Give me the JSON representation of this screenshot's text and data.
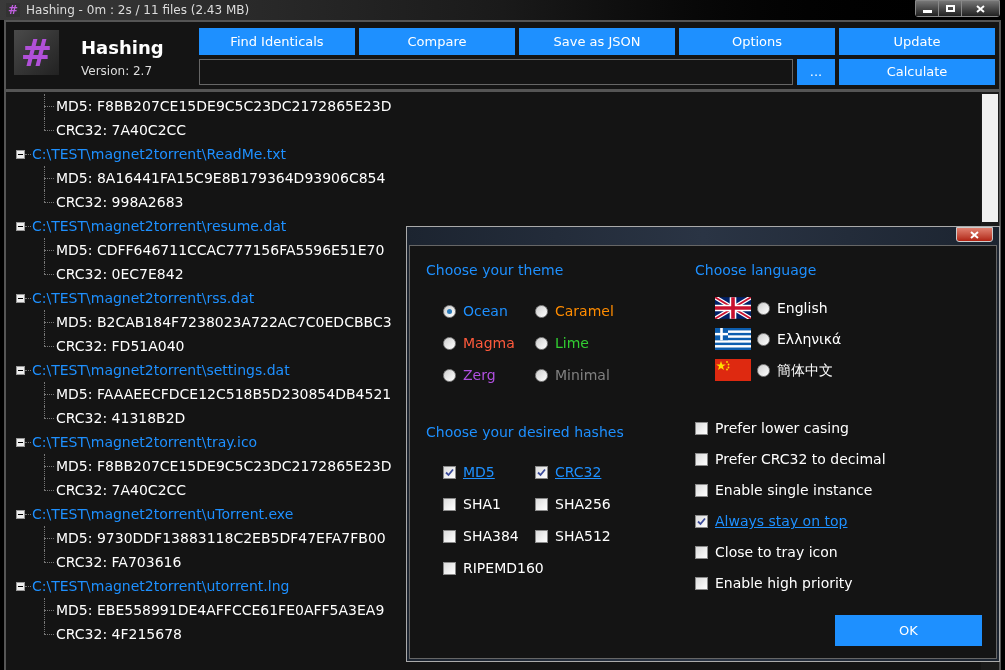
{
  "window": {
    "title": "Hashing - 0m : 2s / 11 files (2.43 MB)"
  },
  "header": {
    "logo": "#",
    "app_name": "Hashing",
    "version": "Version: 2.7"
  },
  "toolbar": [
    "Find Identicals",
    "Compare",
    "Save as JSON",
    "Options",
    "Update"
  ],
  "browse_button": "...",
  "calculate_button": "Calculate",
  "tree": [
    {
      "hashes": [
        "MD5: F8BB207CE15DE9C5C23DC2172865E23D",
        "CRC32: 7A40C2CC"
      ]
    },
    {
      "path": "C:\\TEST\\magnet2torrent\\ReadMe.txt",
      "expanded": true,
      "hashes": [
        "MD5: 8A16441FA15C9E8B179364D93906C854",
        "CRC32: 998A2683"
      ]
    },
    {
      "path": "C:\\TEST\\magnet2torrent\\resume.dat",
      "expanded": true,
      "hashes": [
        "MD5: CDFF646711CCAC777156FA5596E51E70",
        "CRC32: 0EC7E842"
      ]
    },
    {
      "path": "C:\\TEST\\magnet2torrent\\rss.dat",
      "expanded": true,
      "hashes": [
        "MD5: B2CAB184F7238023A722AC7C0EDCBBC3",
        "CRC32: FD51A040"
      ]
    },
    {
      "path": "C:\\TEST\\magnet2torrent\\settings.dat",
      "expanded": true,
      "hashes": [
        "MD5: FAAAEECFDCE12C518B5D230854DB4521",
        "CRC32: 41318B2D"
      ]
    },
    {
      "path": "C:\\TEST\\magnet2torrent\\tray.ico",
      "expanded": true,
      "hashes": [
        "MD5: F8BB207CE15DE9C5C23DC2172865E23D",
        "CRC32: 7A40C2CC"
      ]
    },
    {
      "path": "C:\\TEST\\magnet2torrent\\uTorrent.exe",
      "expanded": true,
      "hashes": [
        "MD5: 9730DDF13883118C2EB5DF47EFA7FB00",
        "CRC32: FA703616"
      ]
    },
    {
      "path": "C:\\TEST\\magnet2torrent\\utorrent.lng",
      "expanded": true,
      "hashes": [
        "MD5: EBE558991DE4AFFCCE61FE0AFF5A3EA9",
        "CRC32: 4F215678"
      ]
    }
  ],
  "options_dialog": {
    "theme_heading": "Choose your theme",
    "themes": [
      {
        "label": "Ocean",
        "color": "#1e90ff",
        "selected": true
      },
      {
        "label": "Caramel",
        "color": "#ff8c00",
        "selected": false
      },
      {
        "label": "Magma",
        "color": "#ff5a3c",
        "selected": false
      },
      {
        "label": "Lime",
        "color": "#32cd32",
        "selected": false
      },
      {
        "label": "Zerg",
        "color": "#b050e0",
        "selected": false
      },
      {
        "label": "Minimal",
        "color": "#808080",
        "selected": false
      }
    ],
    "language_heading": "Choose language",
    "languages": [
      {
        "label": "English",
        "kind": "uk",
        "selected": false
      },
      {
        "label": "Ελληνικά",
        "kind": "greece",
        "selected": false
      },
      {
        "label": "簡体中文",
        "kind": "china",
        "selected": false
      }
    ],
    "hashes_heading": "Choose your desired hashes",
    "hashes": [
      {
        "label": "MD5",
        "checked": true
      },
      {
        "label": "CRC32",
        "checked": true
      },
      {
        "label": "SHA1",
        "checked": false
      },
      {
        "label": "SHA256",
        "checked": false
      },
      {
        "label": "SHA384",
        "checked": false
      },
      {
        "label": "SHA512",
        "checked": false
      },
      {
        "label": "RIPEMD160",
        "checked": false
      }
    ],
    "settings": [
      {
        "label": "Prefer lower casing",
        "checked": false
      },
      {
        "label": "Prefer CRC32 to decimal",
        "checked": false
      },
      {
        "label": "Enable single instance",
        "checked": false
      },
      {
        "label": "Always stay on top",
        "checked": true
      },
      {
        "label": "Close to tray icon",
        "checked": false
      },
      {
        "label": "Enable high priority",
        "checked": false
      }
    ],
    "ok_button": "OK"
  }
}
